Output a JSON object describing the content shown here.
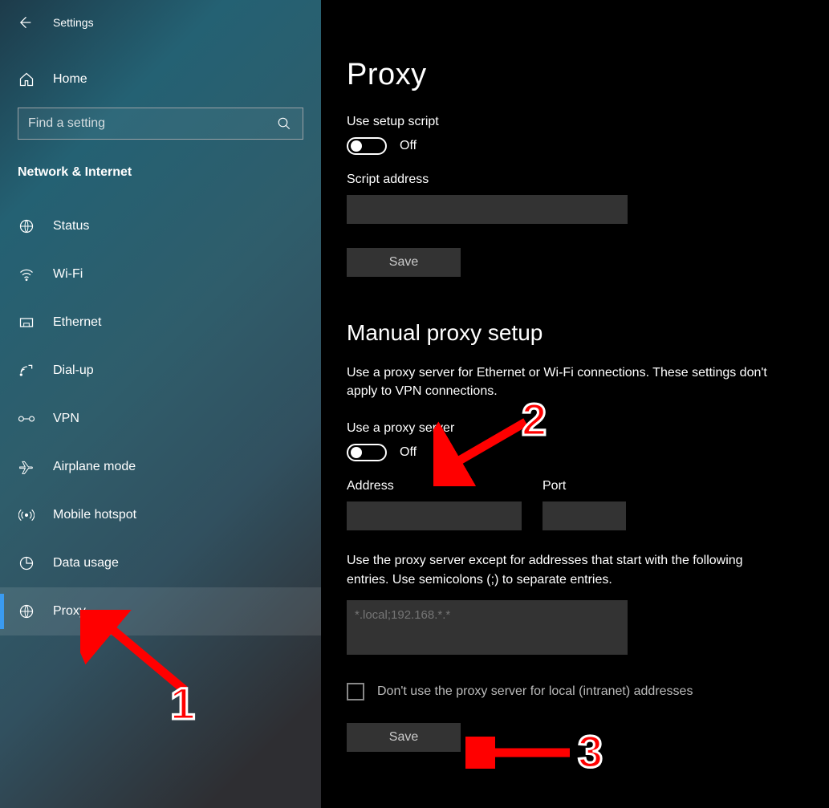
{
  "titlebar": {
    "title": "Settings"
  },
  "home_label": "Home",
  "search_placeholder": "Find a setting",
  "category": "Network & Internet",
  "nav": [
    {
      "key": "status",
      "label": "Status"
    },
    {
      "key": "wifi",
      "label": "Wi-Fi"
    },
    {
      "key": "ethernet",
      "label": "Ethernet"
    },
    {
      "key": "dialup",
      "label": "Dial-up"
    },
    {
      "key": "vpn",
      "label": "VPN"
    },
    {
      "key": "airplane",
      "label": "Airplane mode"
    },
    {
      "key": "hotspot",
      "label": "Mobile hotspot"
    },
    {
      "key": "datausage",
      "label": "Data usage"
    },
    {
      "key": "proxy",
      "label": "Proxy"
    }
  ],
  "page": {
    "title": "Proxy",
    "setup_script_label": "Use setup script",
    "setup_script_state": "Off",
    "script_address_label": "Script address",
    "script_address_value": "",
    "save_label": "Save",
    "manual_heading": "Manual proxy setup",
    "manual_desc": "Use a proxy server for Ethernet or Wi-Fi connections. These settings don't apply to VPN connections.",
    "use_proxy_label": "Use a proxy server",
    "use_proxy_state": "Off",
    "address_label": "Address",
    "address_value": "",
    "port_label": "Port",
    "port_value": "",
    "exceptions_label": "Use the proxy server except for addresses that start with the following entries. Use semicolons (;) to separate entries.",
    "exceptions_placeholder": "*.local;192.168.*.*",
    "exceptions_value": "",
    "local_bypass_label": "Don't use the proxy server for local (intranet) addresses",
    "save2_label": "Save"
  },
  "annotations": {
    "n1": "1",
    "n2": "2",
    "n3": "3"
  }
}
